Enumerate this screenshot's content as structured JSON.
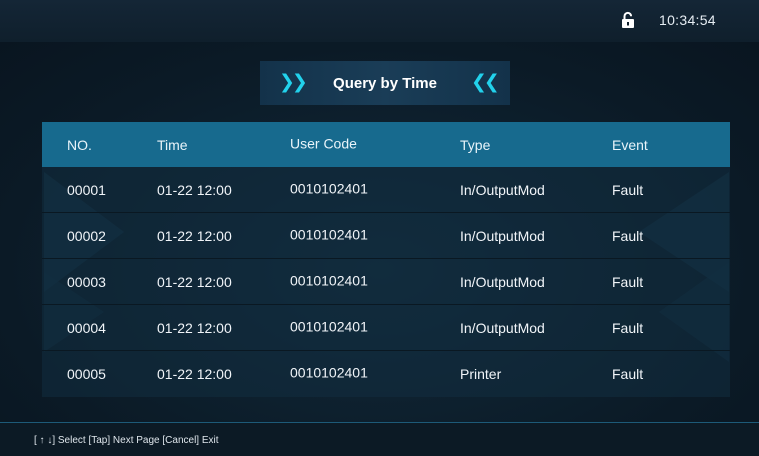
{
  "status": {
    "time": "10:34:54",
    "lock_icon": "unlocked-padlock-icon"
  },
  "title": {
    "left_icon": "double-chevron-right-icon",
    "text": "Query by Time",
    "right_icon": "double-chevron-left-icon"
  },
  "table": {
    "headers": [
      "NO.",
      "Time",
      "User Code",
      "Type",
      "Event"
    ],
    "rows": [
      [
        "00001",
        "01-22 12:00",
        "0010102401",
        "In/OutputMod",
        "Fault"
      ],
      [
        "00002",
        "01-22 12:00",
        "0010102401",
        "In/OutputMod",
        "Fault"
      ],
      [
        "00003",
        "01-22 12:00",
        "0010102401",
        "In/OutputMod",
        "Fault"
      ],
      [
        "00004",
        "01-22 12:00",
        "0010102401",
        "In/OutputMod",
        "Fault"
      ],
      [
        "00005",
        "01-22 12:00",
        "0010102401",
        "Printer",
        "Fault"
      ]
    ]
  },
  "footer": {
    "hint": "[ ↑ ↓] Select   [Tap] Next Page   [Cancel] Exit"
  },
  "colors": {
    "accent": "#22d2ec",
    "header_bg": "#176a8e",
    "background": "#0d1b27"
  }
}
